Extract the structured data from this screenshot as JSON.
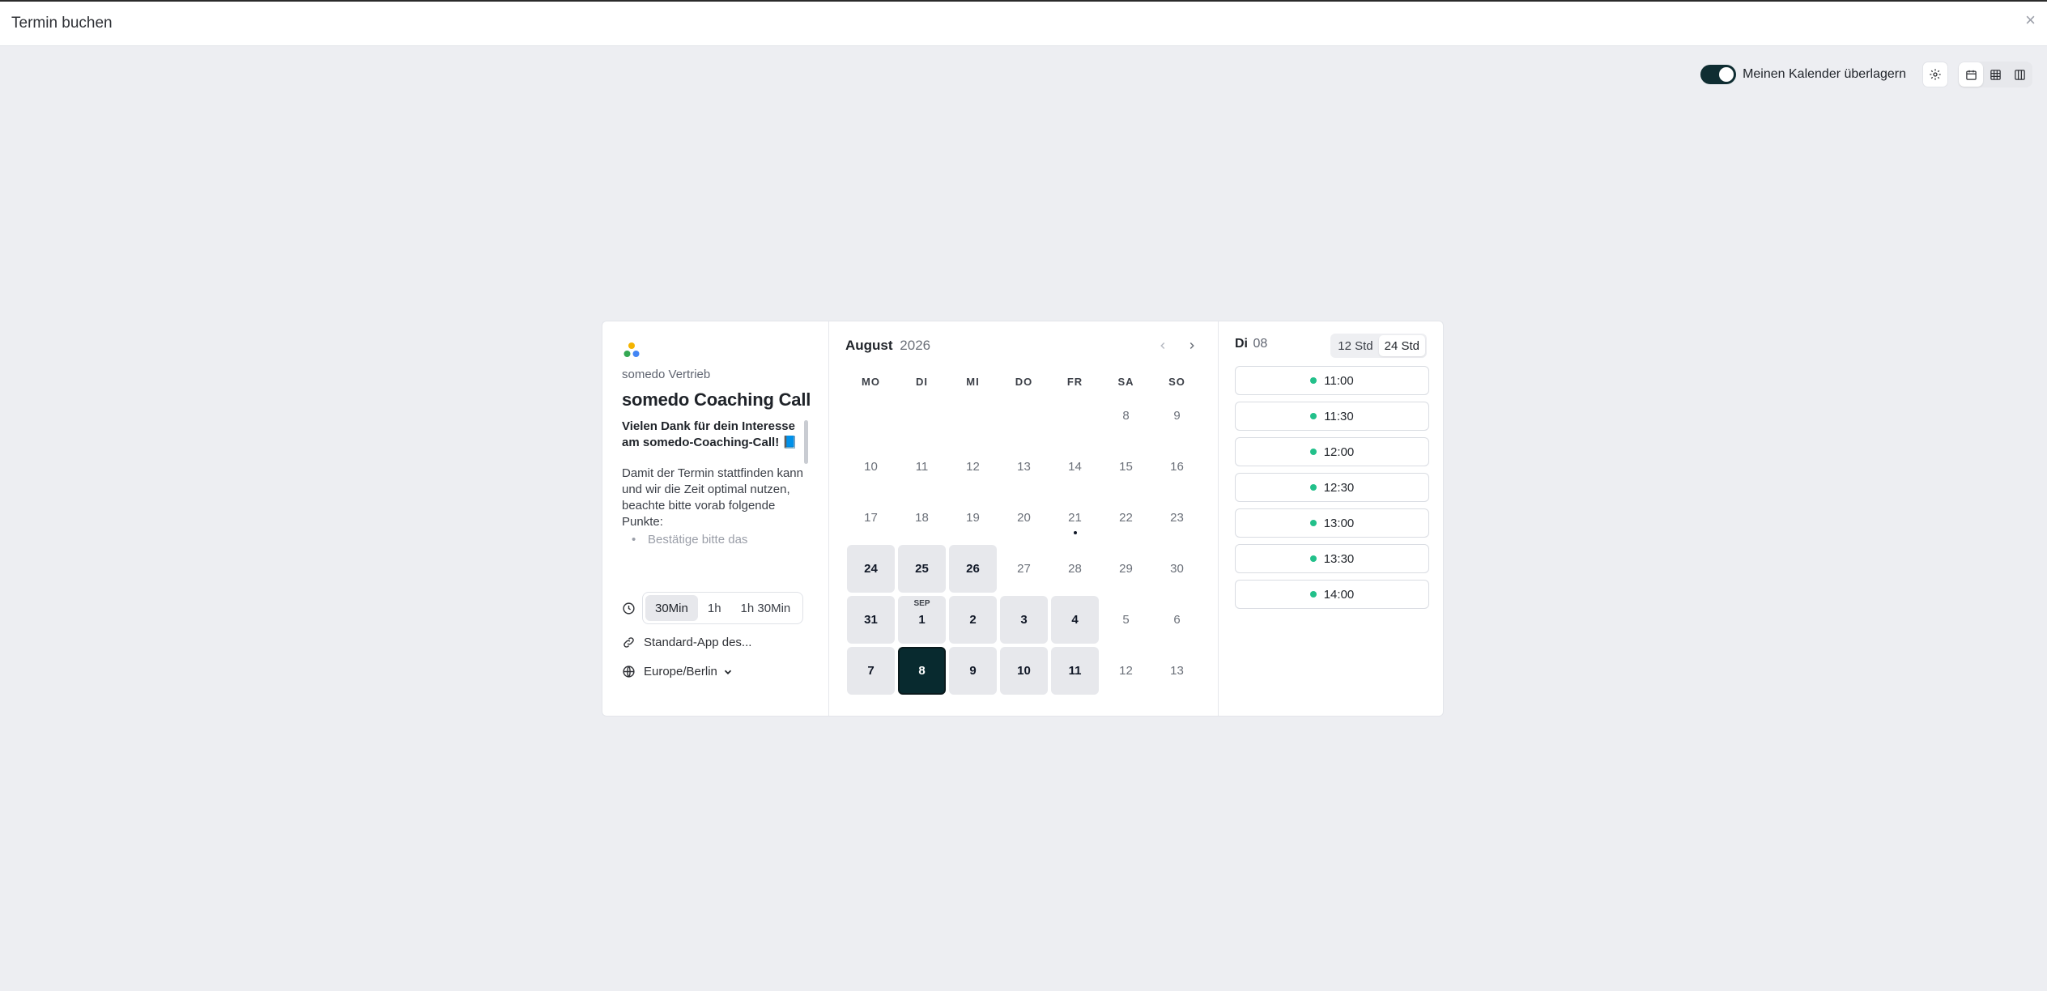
{
  "window": {
    "title": "Termin buchen",
    "close": "×"
  },
  "toolbar": {
    "overlay_label": "Meinen Kalender überlagern",
    "overlay_on": true
  },
  "colors": {
    "accent": "#082a2f",
    "available_dot": "#22c08a",
    "available_day_bg": "#e7e8ec"
  },
  "event": {
    "org": "somedo Vertrieb",
    "title": "somedo Coaching Call",
    "desc_bold": "Vielen Dank für dein Interesse am somedo-Coaching-Call! 📘",
    "desc_text": "Damit der Termin stattfinden kann und wir die Zeit optimal nutzen, beachte bitte vorab folgende Punkte:",
    "desc_bullet": "Bestätige bitte das",
    "durations": [
      "30Min",
      "1h",
      "1h 30Min"
    ],
    "location": "Standard-App des...",
    "timezone": "Europe/Berlin"
  },
  "calendar": {
    "month": "August",
    "year": "2026",
    "weekdays": [
      "MO",
      "DI",
      "MI",
      "DO",
      "FR",
      "SA",
      "SO"
    ],
    "next_month_tag": "SEP",
    "days": [
      {
        "d": "8",
        "r": 0,
        "c": 5,
        "s": "muted"
      },
      {
        "d": "9",
        "r": 0,
        "c": 6,
        "s": "muted"
      },
      {
        "d": "10",
        "r": 1,
        "c": 0,
        "s": "muted"
      },
      {
        "d": "11",
        "r": 1,
        "c": 1,
        "s": "muted"
      },
      {
        "d": "12",
        "r": 1,
        "c": 2,
        "s": "muted"
      },
      {
        "d": "13",
        "r": 1,
        "c": 3,
        "s": "muted"
      },
      {
        "d": "14",
        "r": 1,
        "c": 4,
        "s": "muted"
      },
      {
        "d": "15",
        "r": 1,
        "c": 5,
        "s": "muted"
      },
      {
        "d": "16",
        "r": 1,
        "c": 6,
        "s": "muted"
      },
      {
        "d": "17",
        "r": 2,
        "c": 0,
        "s": "muted"
      },
      {
        "d": "18",
        "r": 2,
        "c": 1,
        "s": "muted"
      },
      {
        "d": "19",
        "r": 2,
        "c": 2,
        "s": "muted"
      },
      {
        "d": "20",
        "r": 2,
        "c": 3,
        "s": "muted"
      },
      {
        "d": "21",
        "r": 2,
        "c": 4,
        "s": "today"
      },
      {
        "d": "22",
        "r": 2,
        "c": 5,
        "s": "muted"
      },
      {
        "d": "23",
        "r": 2,
        "c": 6,
        "s": "muted"
      },
      {
        "d": "24",
        "r": 3,
        "c": 0,
        "s": "avail"
      },
      {
        "d": "25",
        "r": 3,
        "c": 1,
        "s": "avail"
      },
      {
        "d": "26",
        "r": 3,
        "c": 2,
        "s": "avail"
      },
      {
        "d": "27",
        "r": 3,
        "c": 3,
        "s": "muted"
      },
      {
        "d": "28",
        "r": 3,
        "c": 4,
        "s": "muted"
      },
      {
        "d": "29",
        "r": 3,
        "c": 5,
        "s": "muted"
      },
      {
        "d": "30",
        "r": 3,
        "c": 6,
        "s": "muted"
      },
      {
        "d": "31",
        "r": 4,
        "c": 0,
        "s": "avail"
      },
      {
        "d": "1",
        "r": 4,
        "c": 1,
        "s": "avail",
        "tag": true
      },
      {
        "d": "2",
        "r": 4,
        "c": 2,
        "s": "avail"
      },
      {
        "d": "3",
        "r": 4,
        "c": 3,
        "s": "avail"
      },
      {
        "d": "4",
        "r": 4,
        "c": 4,
        "s": "avail"
      },
      {
        "d": "5",
        "r": 4,
        "c": 5,
        "s": "muted"
      },
      {
        "d": "6",
        "r": 4,
        "c": 6,
        "s": "muted"
      },
      {
        "d": "7",
        "r": 5,
        "c": 0,
        "s": "avail"
      },
      {
        "d": "8",
        "r": 5,
        "c": 1,
        "s": "selected"
      },
      {
        "d": "9",
        "r": 5,
        "c": 2,
        "s": "avail"
      },
      {
        "d": "10",
        "r": 5,
        "c": 3,
        "s": "avail"
      },
      {
        "d": "11",
        "r": 5,
        "c": 4,
        "s": "avail"
      },
      {
        "d": "12",
        "r": 5,
        "c": 5,
        "s": "muted"
      },
      {
        "d": "13",
        "r": 5,
        "c": 6,
        "s": "muted"
      }
    ]
  },
  "slots": {
    "day_name": "Di",
    "day_num": "08",
    "format_options": [
      "12 Std",
      "24 Std"
    ],
    "times": [
      "11:00",
      "11:30",
      "12:00",
      "12:30",
      "13:00",
      "13:30",
      "14:00"
    ]
  }
}
